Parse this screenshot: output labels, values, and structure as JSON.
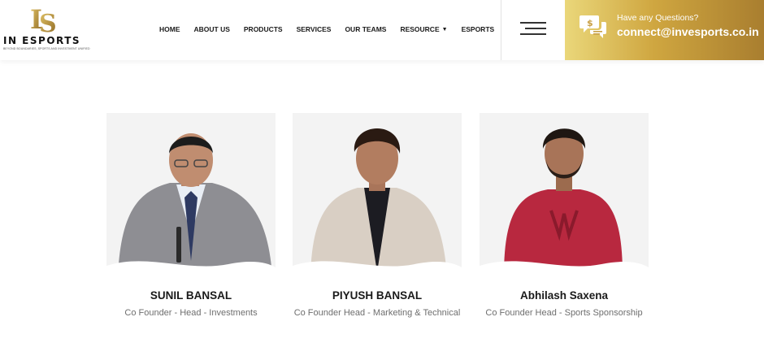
{
  "header": {
    "logo": {
      "monogram": "IS",
      "wordmark": "IN ESPORTS",
      "tagline": "BEYOND BOUNDARIES, SPORTS AND INVESTMENT UNIFIED"
    },
    "nav": [
      {
        "label": "HOME"
      },
      {
        "label": "ABOUT US"
      },
      {
        "label": "PRODUCTS"
      },
      {
        "label": "SERVICES"
      },
      {
        "label": "OUR TEAMS"
      },
      {
        "label": "RESOURCE",
        "has_dropdown": true
      },
      {
        "label": "ESPORTS"
      }
    ],
    "contact": {
      "question": "Have any Questions?",
      "email": "connect@invesports.co.in"
    }
  },
  "team": [
    {
      "name": "SUNIL BANSAL",
      "role": "Co Founder - Head - Investments"
    },
    {
      "name": "PIYUSH BANSAL",
      "role": "Co Founder Head - Marketing & Technical"
    },
    {
      "name": "Abhilash Saxena",
      "role": "Co Founder Head - Sports Sponsorship"
    }
  ],
  "colors": {
    "gold_light": "#ead77a",
    "gold_dark": "#a97e2f",
    "card_bg": "#f3f3f3",
    "text_dark": "#1a1a1a",
    "text_muted": "#6e6e6e"
  }
}
